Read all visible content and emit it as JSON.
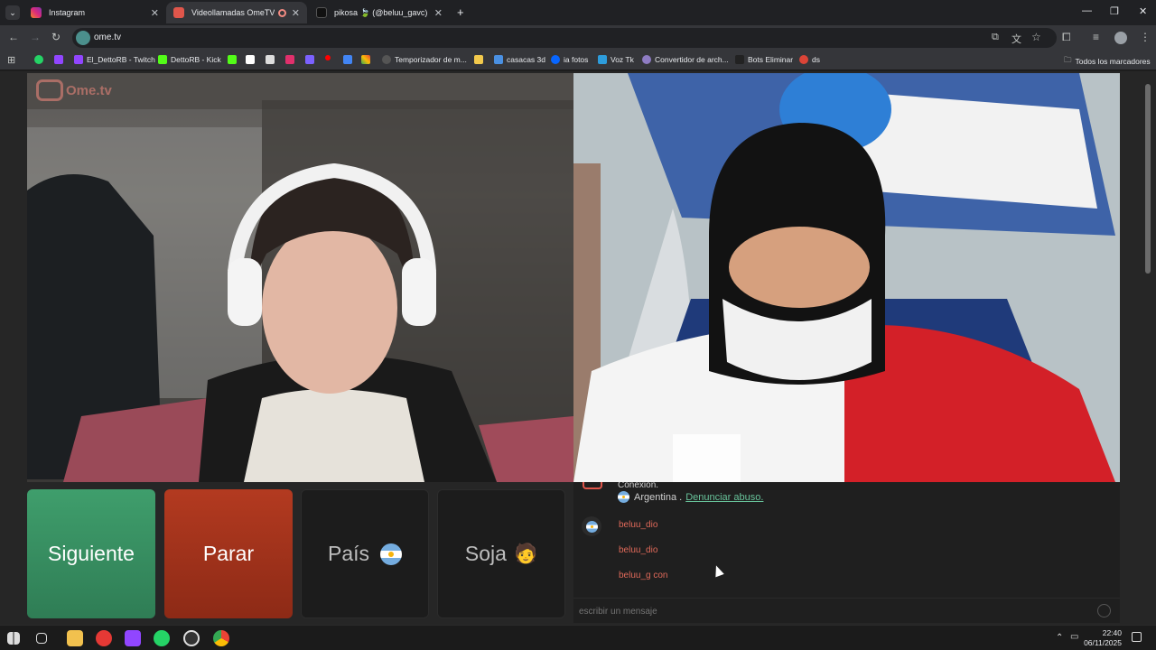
{
  "browser": {
    "tabs": [
      {
        "title": "Instagram",
        "active": false,
        "icon": "instagram-icon",
        "color": "#e1306c"
      },
      {
        "title": "Videollamadas OmeTV — A",
        "active": true,
        "icon": "ometv-icon",
        "color": "#e0564b"
      },
      {
        "title": "pikosa 🍃 (@beluu_gavc) | TikT",
        "active": false,
        "icon": "tiktok-icon",
        "color": "#111111"
      }
    ],
    "url": "ome.tv",
    "bookmarks": [
      {
        "label": "",
        "icon": "whatsapp-icon",
        "color": "#25d366"
      },
      {
        "label": "",
        "icon": "twitch-icon",
        "color": "#9146ff"
      },
      {
        "label": "El_DettoRB - Twitch",
        "icon": "twitch-icon",
        "color": "#9146ff"
      },
      {
        "label": "DettoRB - Kick",
        "icon": "kick-icon",
        "color": "#53fc18"
      },
      {
        "label": "",
        "icon": "kick-icon",
        "color": "#53fc18"
      },
      {
        "label": "",
        "icon": "tiktok-icon",
        "color": "#ffffff"
      },
      {
        "label": "",
        "icon": "x-icon",
        "color": "#ffffff"
      },
      {
        "label": "",
        "icon": "instagram-icon",
        "color": "#e1306c"
      },
      {
        "label": "",
        "icon": "app-icon",
        "color": "#7b61ff"
      },
      {
        "label": "",
        "icon": "youtube-icon",
        "color": "#ff0000"
      },
      {
        "label": "",
        "icon": "puzzle-icon",
        "color": "#4285f4"
      },
      {
        "label": "Temporizador de m...",
        "icon": "timer-icon",
        "color": "#9aa0a6"
      },
      {
        "label": "",
        "icon": "card-icon",
        "color": "#f2c94c"
      },
      {
        "label": "casacas 3d",
        "icon": "shirt-icon",
        "color": "#4a90e2"
      },
      {
        "label": "ia fotos",
        "icon": "meta-icon",
        "color": "#0866ff"
      },
      {
        "label": "Voz Tk",
        "icon": "voice-icon",
        "color": "#2d9cdb"
      },
      {
        "label": "Convertidor de arch...",
        "icon": "convert-icon",
        "color": "#8e7cc3"
      },
      {
        "label": "Bots Eliminar",
        "icon": "bot-icon",
        "color": "#222222"
      },
      {
        "label": "ds",
        "icon": "chrome-icon",
        "color": "#db4437"
      }
    ],
    "all_bookmarks_label": "Todos los marcadores"
  },
  "ometv": {
    "logo_text": "Ome.tv",
    "buttons": {
      "next": "Siguiente",
      "stop": "Parar",
      "country": "País",
      "gender": "Soja",
      "gender_emoji": "🧑"
    },
    "chat": {
      "connection_text": "Conexión.",
      "country": "Argentina .",
      "report": "Denunciar abuso.",
      "messages": [
        "beluu_dio",
        "beluu_dio",
        "beluu_g con"
      ],
      "input_placeholder": "escribir un mensaje"
    },
    "accent_green": "#3f9e6c",
    "accent_red": "#a8351d"
  },
  "taskbar": {
    "time": "22:40",
    "date": "06/11/2025"
  }
}
